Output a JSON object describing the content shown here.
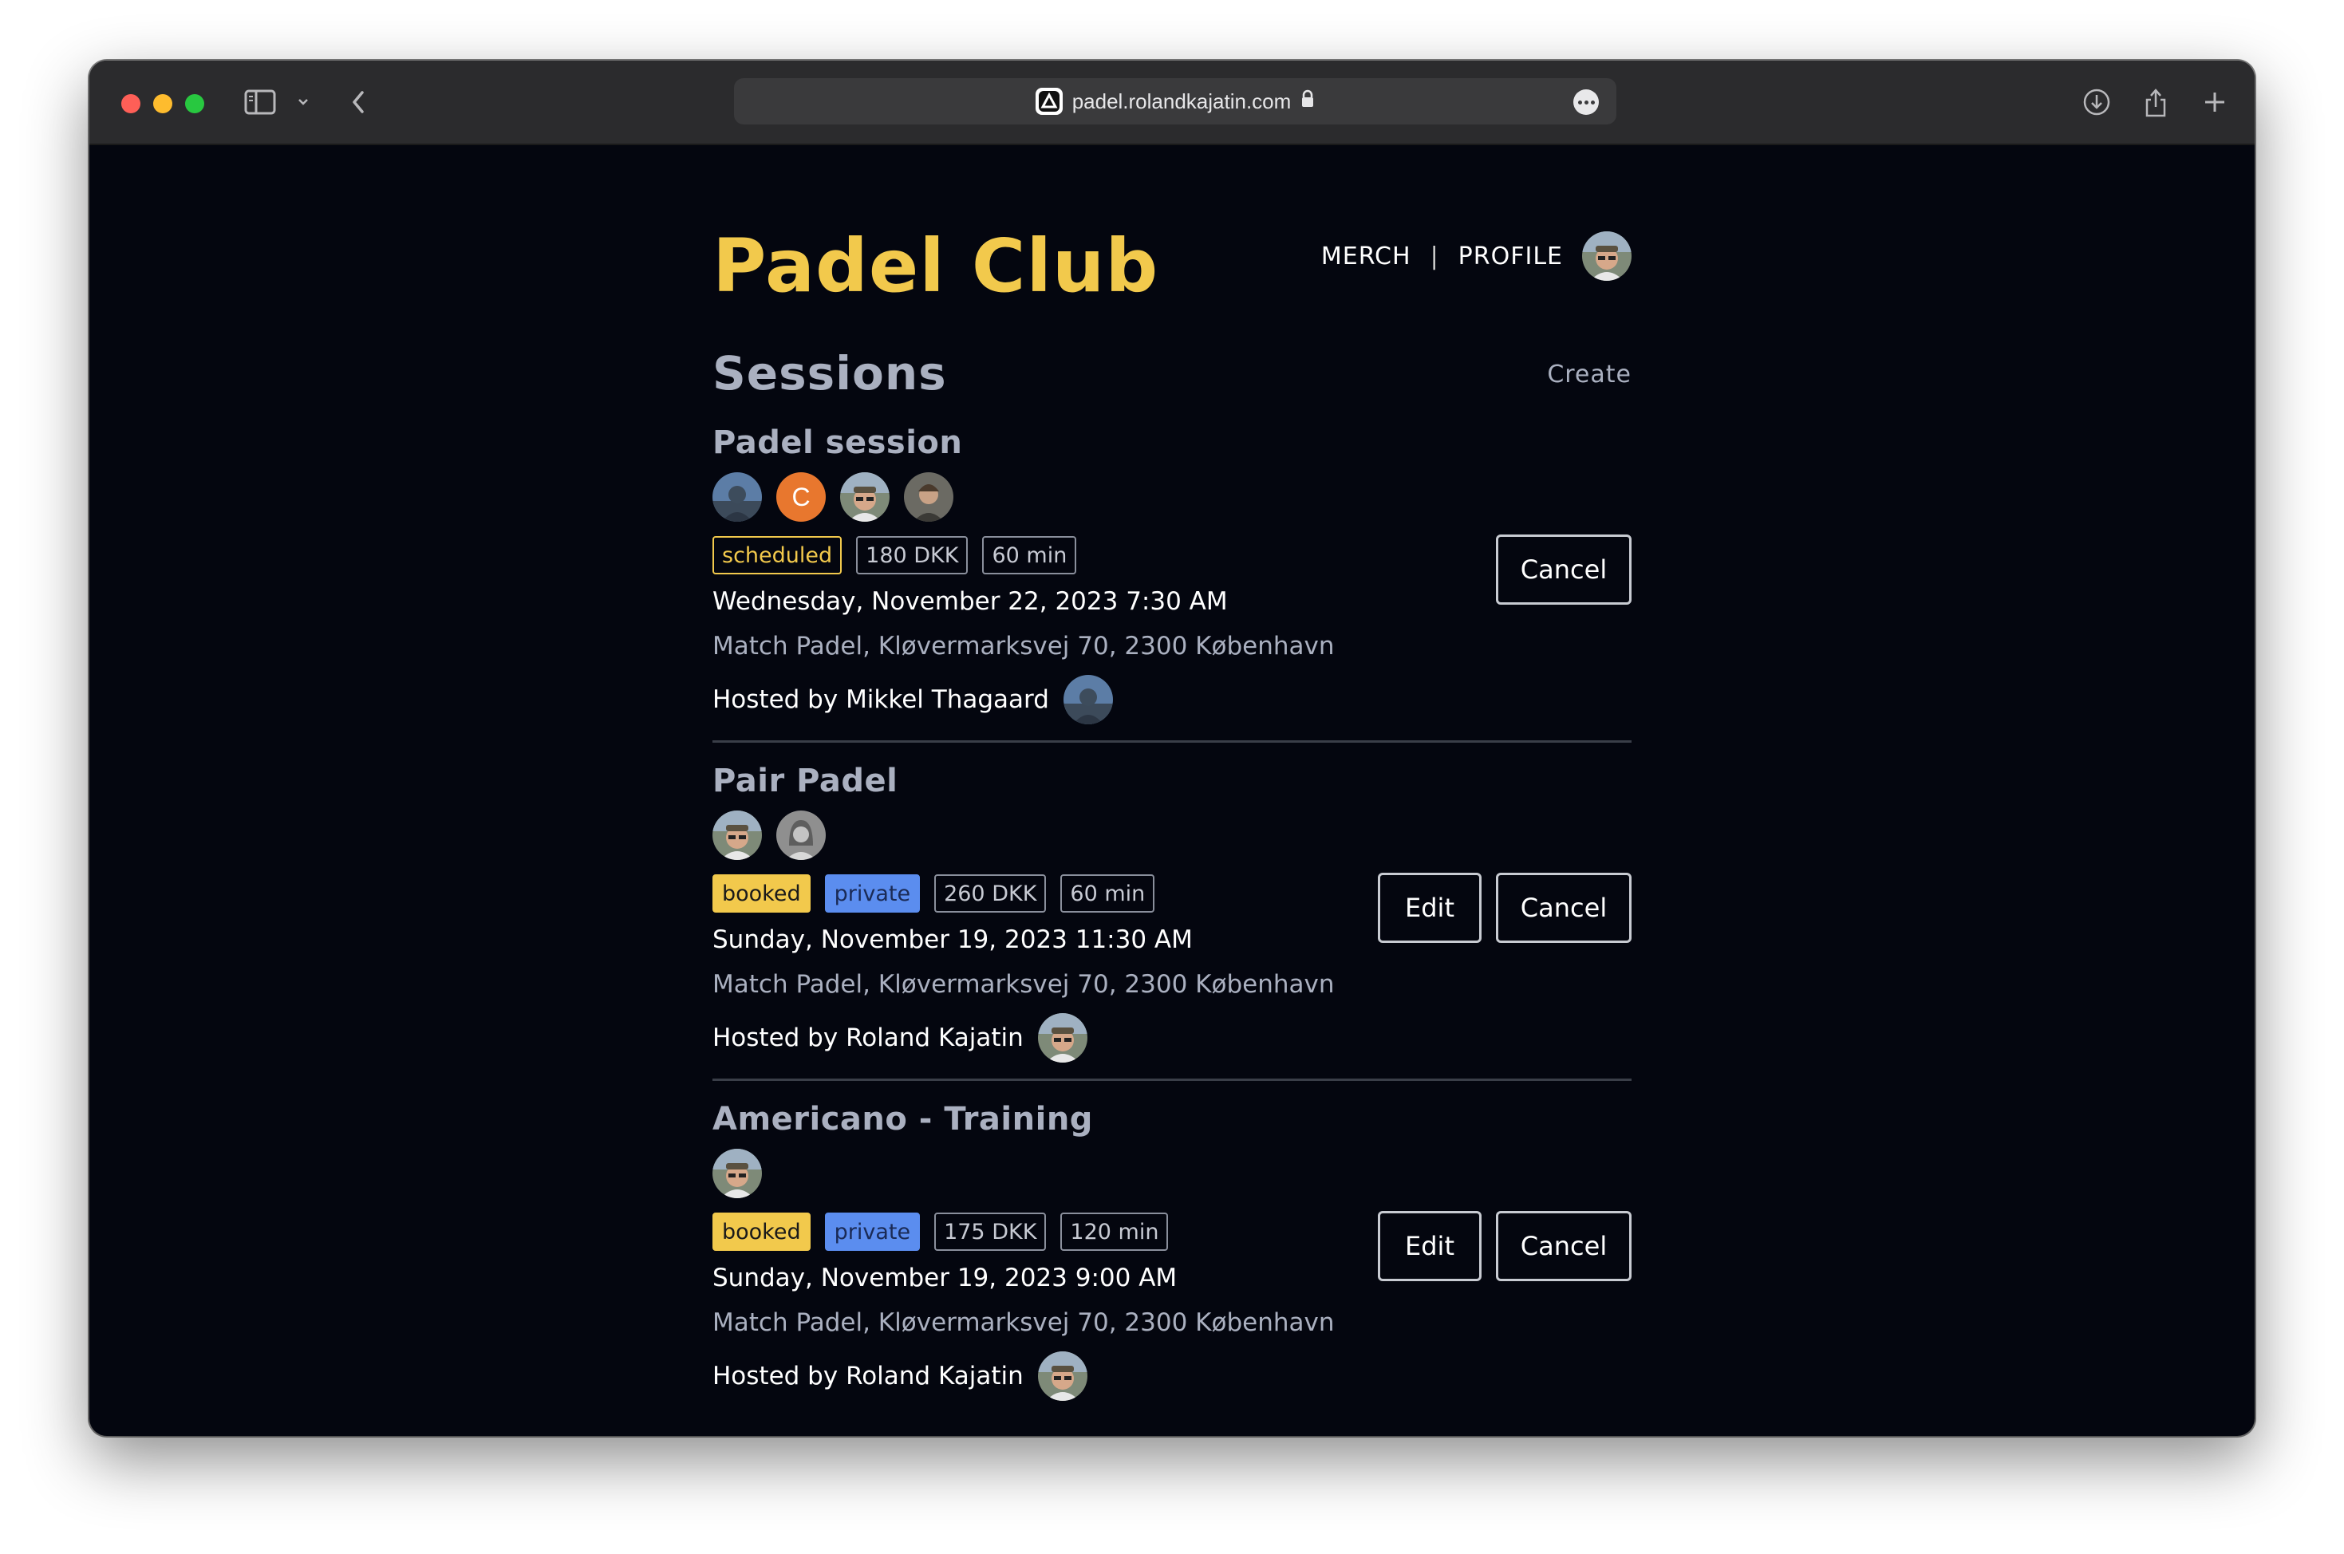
{
  "browser": {
    "url": "padel.rolandkajatin.com"
  },
  "app": {
    "brand": "Padel Club",
    "nav": {
      "merch": "MERCH",
      "separator": "|",
      "profile": "PROFILE"
    }
  },
  "page": {
    "heading": "Sessions",
    "create_label": "Create"
  },
  "sessions": [
    {
      "title": "Padel session",
      "participants": [
        "avatar-photo",
        "C",
        "avatar-photo",
        "avatar-photo"
      ],
      "tags": {
        "status": "scheduled",
        "price": "180 DKK",
        "duration": "60 min"
      },
      "date": "Wednesday, November 22, 2023 7:30 AM",
      "location": "Match Padel, Kløvermarksvej 70, 2300 København",
      "host": "Hosted by Mikkel Thagaard",
      "actions": {
        "cancel": "Cancel"
      }
    },
    {
      "title": "Pair Padel",
      "participants": [
        "avatar-photo",
        "avatar-photo"
      ],
      "tags": {
        "status": "booked",
        "visibility": "private",
        "price": "260 DKK",
        "duration": "60 min"
      },
      "date": "Sunday, November 19, 2023 11:30 AM",
      "location": "Match Padel, Kløvermarksvej 70, 2300 København",
      "host": "Hosted by Roland Kajatin",
      "actions": {
        "edit": "Edit",
        "cancel": "Cancel"
      }
    },
    {
      "title": "Americano - Training",
      "participants": [
        "avatar-photo"
      ],
      "tags": {
        "status": "booked",
        "visibility": "private",
        "price": "175 DKK",
        "duration": "120 min"
      },
      "date": "Sunday, November 19, 2023 9:00 AM",
      "location": "Match Padel, Kløvermarksvej 70, 2300 København",
      "host": "Hosted by Roland Kajatin",
      "actions": {
        "edit": "Edit",
        "cancel": "Cancel"
      }
    }
  ],
  "colors": {
    "accent": "#f2c94c",
    "private": "#5b8def",
    "background": "#04060f",
    "muted_text": "#aab0c0"
  }
}
